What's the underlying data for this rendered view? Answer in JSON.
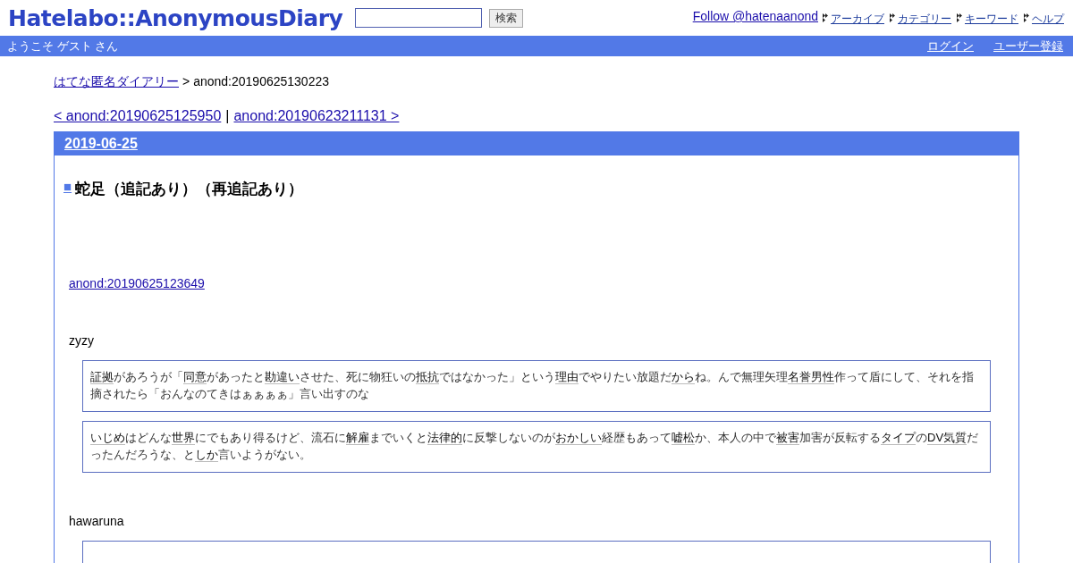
{
  "header": {
    "logo": "Hatelabo::AnonymousDiary",
    "search": {
      "button": "検索"
    },
    "follow": "Follow @hatenaanond",
    "nav": [
      "アーカイブ",
      "カテゴリー",
      "キーワード",
      "ヘルプ"
    ]
  },
  "userbar": {
    "welcome": "ようこそ ゲスト さん",
    "links": [
      "ログイン",
      "ユーザー登録"
    ]
  },
  "breadcrumb": {
    "home": "はてな匿名ダイアリー",
    "separator": ">",
    "current": "anond:20190625130223"
  },
  "pager": {
    "prev": "< anond:20190625125950",
    "separator": "|",
    "next": "anond:20190623211131 >"
  },
  "day": {
    "date": "2019-06-25",
    "title_mark": "■",
    "title": "蛇足（追記あり）（再追記あり）",
    "link": "anond:20190625123649",
    "sections": [
      {
        "author": "zyzy",
        "quotes": [
          [
            {
              "text": "証拠",
              "keyword": true
            },
            {
              "text": "があろうが「",
              "keyword": false
            },
            {
              "text": "同意",
              "keyword": true
            },
            {
              "text": "があったと",
              "keyword": false
            },
            {
              "text": "勘違い",
              "keyword": true
            },
            {
              "text": "させた、死に物狂いの",
              "keyword": false
            },
            {
              "text": "抵抗",
              "keyword": true
            },
            {
              "text": "ではなかった」という",
              "keyword": false
            },
            {
              "text": "理由",
              "keyword": true
            },
            {
              "text": "でやりたい放題だ",
              "keyword": false
            },
            {
              "text": "から",
              "keyword": true
            },
            {
              "text": "ね。んで無理矢理",
              "keyword": false
            },
            {
              "text": "名誉男性",
              "keyword": true
            },
            {
              "text": "作って盾にして、それを指摘されたら「おんなのてきはぁぁぁぁ」言い出すのな",
              "keyword": false
            }
          ],
          [
            {
              "text": "いじめ",
              "keyword": true
            },
            {
              "text": "はどんな",
              "keyword": false
            },
            {
              "text": "世界",
              "keyword": true
            },
            {
              "text": "にでもあり得るけど、流石に",
              "keyword": false
            },
            {
              "text": "解雇",
              "keyword": true
            },
            {
              "text": "までいくと",
              "keyword": false
            },
            {
              "text": "法律的",
              "keyword": true
            },
            {
              "text": "に反撃しないのが",
              "keyword": false
            },
            {
              "text": "おかしい",
              "keyword": true
            },
            {
              "text": "経歴もあって",
              "keyword": false
            },
            {
              "text": "嘘松",
              "keyword": true
            },
            {
              "text": "か、本人の中で",
              "keyword": false
            },
            {
              "text": "被害",
              "keyword": true
            },
            {
              "text": "加害が反転する",
              "keyword": false
            },
            {
              "text": "タイプ",
              "keyword": true
            },
            {
              "text": "の",
              "keyword": false
            },
            {
              "text": "DV気質",
              "keyword": true
            },
            {
              "text": "だったんだろうな、と",
              "keyword": false
            },
            {
              "text": "しか",
              "keyword": true
            },
            {
              "text": "言いようがない。",
              "keyword": false
            }
          ]
        ]
      },
      {
        "author": "hawaruna",
        "cut_quote": true
      }
    ]
  }
}
